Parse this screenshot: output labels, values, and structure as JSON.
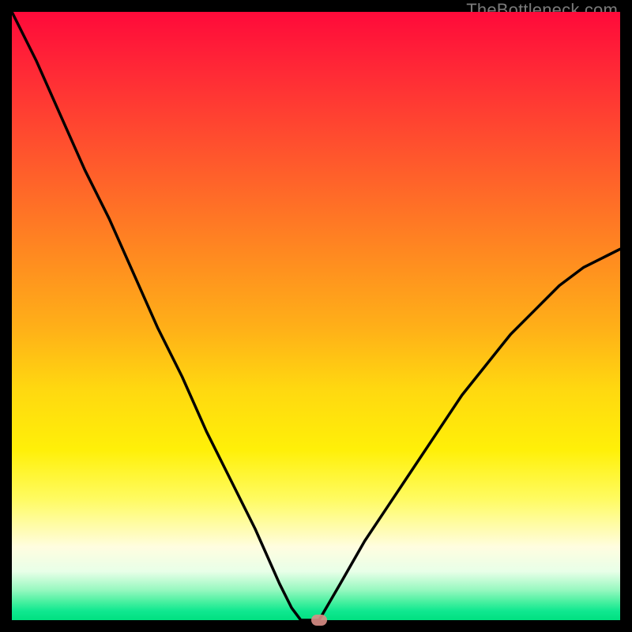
{
  "attribution": "TheBottleneck.com",
  "chart_data": {
    "type": "line",
    "title": "",
    "xlabel": "",
    "ylabel": "",
    "ylim": [
      0,
      100
    ],
    "xlim": [
      0,
      100
    ],
    "series": [
      {
        "name": "left-branch",
        "x": [
          0,
          4,
          8,
          12,
          16,
          20,
          24,
          28,
          32,
          36,
          40,
          44,
          46,
          47.5
        ],
        "values": [
          100,
          92,
          83,
          74,
          66,
          57,
          48,
          40,
          31,
          23,
          15,
          6,
          2,
          0
        ]
      },
      {
        "name": "bottom-flat",
        "x": [
          47.5,
          50.5
        ],
        "values": [
          0,
          0
        ]
      },
      {
        "name": "right-branch",
        "x": [
          50.5,
          54,
          58,
          62,
          66,
          70,
          74,
          78,
          82,
          86,
          90,
          94,
          98,
          100
        ],
        "values": [
          0,
          6,
          13,
          19,
          25,
          31,
          37,
          42,
          47,
          51,
          55,
          58,
          60,
          61
        ]
      }
    ],
    "marker": {
      "x": 50.5,
      "y": 0
    },
    "gradient_stops": [
      {
        "pct": 0,
        "color": "#ff0a3a"
      },
      {
        "pct": 50,
        "color": "#ff9a1c"
      },
      {
        "pct": 78,
        "color": "#fff040"
      },
      {
        "pct": 92,
        "color": "#e8ffe8"
      },
      {
        "pct": 100,
        "color": "#00e080"
      }
    ]
  }
}
